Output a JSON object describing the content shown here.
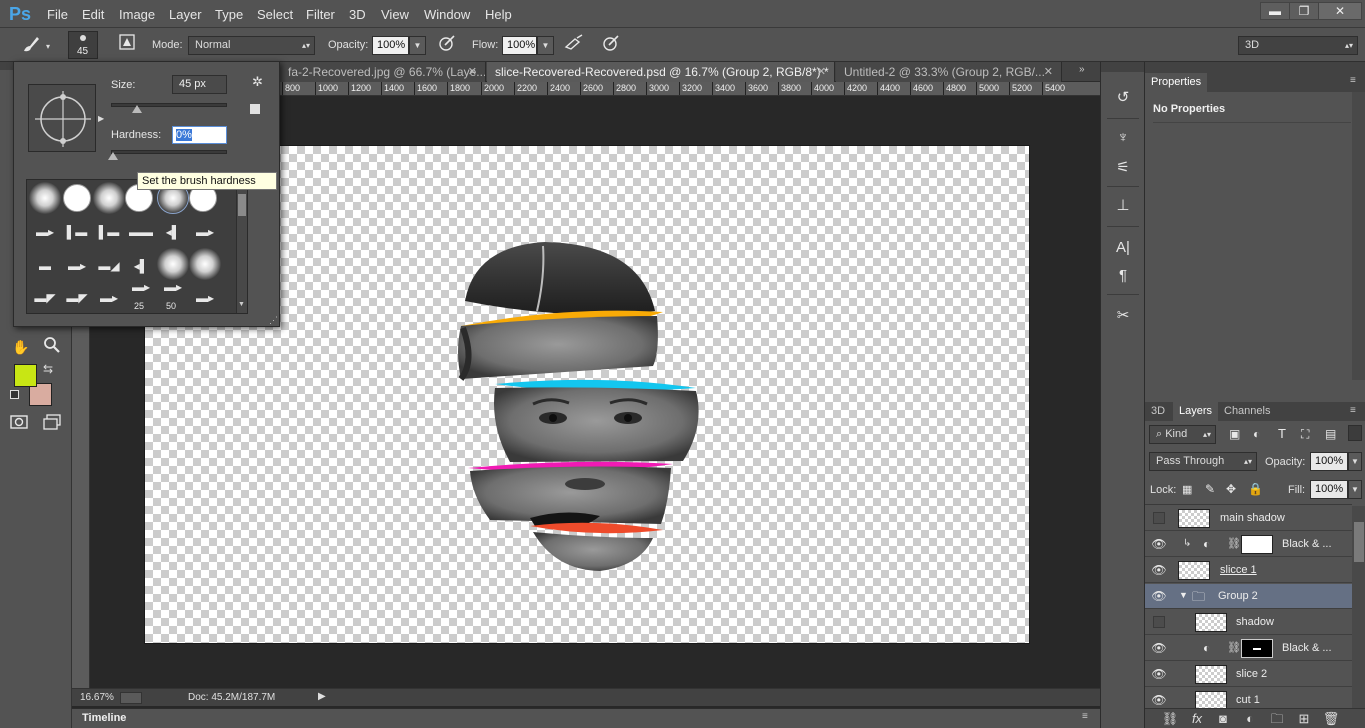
{
  "app": {
    "logo": "Ps",
    "menu": [
      "File",
      "Edit",
      "Image",
      "Layer",
      "Type",
      "Select",
      "Filter",
      "3D",
      "View",
      "Window",
      "Help"
    ],
    "window_buttons": [
      "▬",
      "❐",
      "✕"
    ]
  },
  "options_bar": {
    "brush_size_value": "45",
    "mode_label": "Mode:",
    "mode_value": "Normal",
    "opacity_label": "Opacity:",
    "opacity_value": "100%",
    "flow_label": "Flow:",
    "flow_value": "100%",
    "workspace_value": "3D"
  },
  "document_tabs": [
    {
      "title": "fa-2-Recovered.jpg @ 66.7% (Laye..."
    },
    {
      "title": "slice-Recovered-Recovered.psd @ 16.7% (Group 2, RGB/8*) *"
    },
    {
      "title": "Untitled-2 @ 33.3% (Group 2, RGB/..."
    }
  ],
  "ruler_ticks": [
    "800",
    "1000",
    "1200",
    "1400",
    "1600",
    "1800",
    "2000",
    "2200",
    "2400",
    "2600",
    "2800",
    "3000",
    "3200",
    "3400",
    "3600",
    "3800",
    "4000",
    "4200",
    "4400",
    "4600",
    "4800",
    "5000",
    "5200",
    "5400"
  ],
  "brush_popover": {
    "size_label": "Size:",
    "size_value": "45 px",
    "hardness_label": "Hardness:",
    "hardness_value": "0%",
    "tooltip": "Set the brush hardness",
    "preset_numbers": [
      "25",
      "50"
    ]
  },
  "status_bar": {
    "zoom": "16.67%",
    "doc_info": "Doc: 45.2M/187.7M"
  },
  "timeline": {
    "label": "Timeline"
  },
  "properties_panel": {
    "tab": "Properties",
    "message": "No Properties"
  },
  "layers_panel": {
    "tabs": [
      "3D",
      "Layers",
      "Channels"
    ],
    "filter_kind": "Kind",
    "blend_mode": "Pass Through",
    "opacity_label": "Opacity:",
    "opacity_value": "100%",
    "lock_label": "Lock:",
    "fill_label": "Fill:",
    "fill_value": "100%",
    "layers": [
      {
        "name": "main shadow"
      },
      {
        "name": "Black & ..."
      },
      {
        "name": "slicce 1"
      },
      {
        "name": "Group 2"
      },
      {
        "name": "shadow"
      },
      {
        "name": "Black & ..."
      },
      {
        "name": "slice 2"
      },
      {
        "name": "cut 1"
      }
    ]
  },
  "colors": {
    "foreground": "#c8e614",
    "background": "#d9aca0",
    "slice_orange": "#f8aa06",
    "slice_cyan": "#13c6ef",
    "slice_magenta": "#f11ab4",
    "slice_red": "#ee4b2b",
    "selected_layer": "#657084"
  }
}
